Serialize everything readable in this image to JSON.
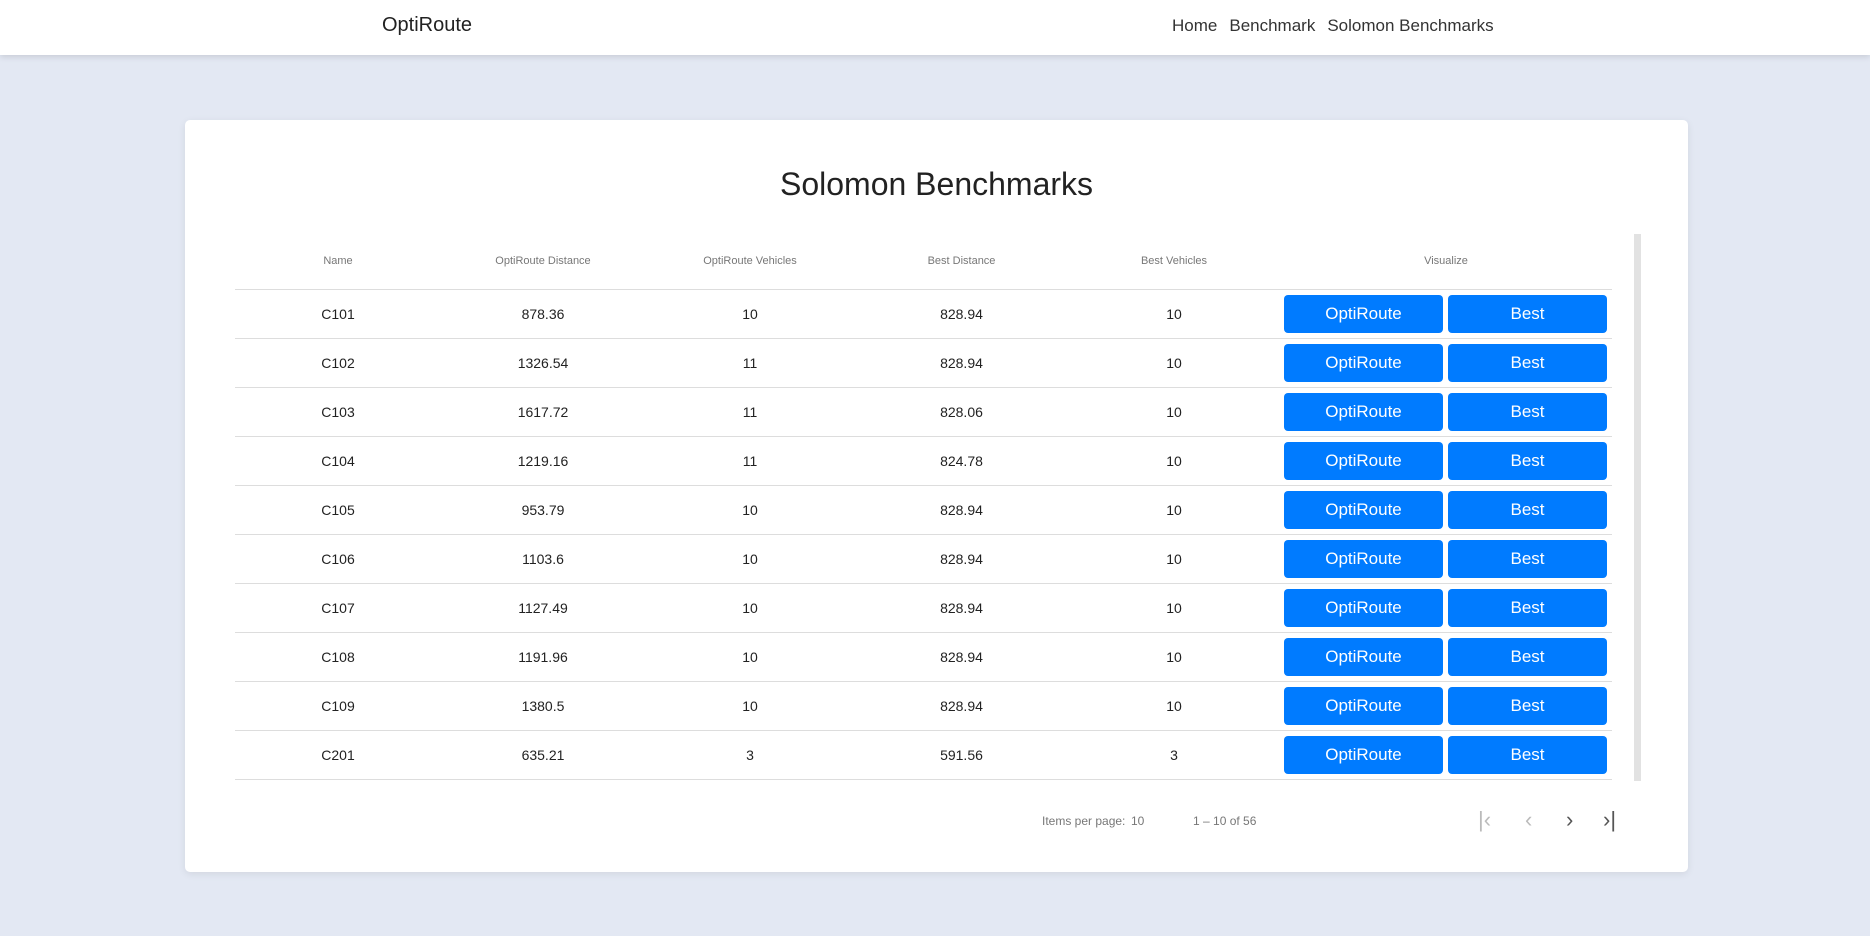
{
  "nav": {
    "brand": "OptiRoute",
    "links": [
      "Home",
      "Benchmark",
      "Solomon Benchmarks"
    ]
  },
  "page": {
    "title": "Solomon Benchmarks"
  },
  "table": {
    "headers": [
      "Name",
      "OptiRoute Distance",
      "OptiRoute Vehicles",
      "Best Distance",
      "Best Vehicles",
      "Visualize"
    ],
    "button_labels": {
      "optiroute": "OptiRoute",
      "best": "Best"
    },
    "rows": [
      [
        "C101",
        "878.36",
        "10",
        "828.94",
        "10"
      ],
      [
        "C102",
        "1326.54",
        "11",
        "828.94",
        "10"
      ],
      [
        "C103",
        "1617.72",
        "11",
        "828.06",
        "10"
      ],
      [
        "C104",
        "1219.16",
        "11",
        "824.78",
        "10"
      ],
      [
        "C105",
        "953.79",
        "10",
        "828.94",
        "10"
      ],
      [
        "C106",
        "1103.6",
        "10",
        "828.94",
        "10"
      ],
      [
        "C107",
        "1127.49",
        "10",
        "828.94",
        "10"
      ],
      [
        "C108",
        "1191.96",
        "10",
        "828.94",
        "10"
      ],
      [
        "C109",
        "1380.5",
        "10",
        "828.94",
        "10"
      ],
      [
        "C201",
        "635.21",
        "3",
        "591.56",
        "3"
      ]
    ]
  },
  "paginator": {
    "items_per_page_label": "Items per page:",
    "items_per_page": "10",
    "range": "1 – 10 of 56"
  },
  "colors": {
    "accent": "#007bff",
    "background": "#e3e8f3"
  }
}
